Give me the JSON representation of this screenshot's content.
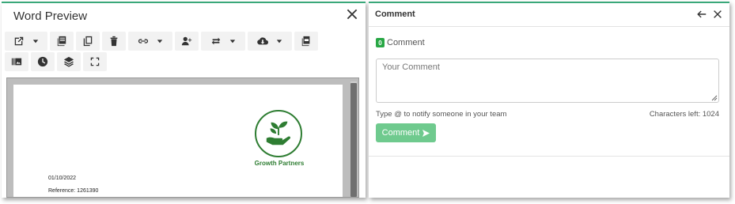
{
  "preview": {
    "title": "Word Preview",
    "toolbar_row1": [
      {
        "icon": "external-link-icon",
        "dropdown": true
      },
      {
        "icon": "copy-pages-icon",
        "dropdown": false
      },
      {
        "icon": "duplicate-icon",
        "dropdown": false
      },
      {
        "icon": "trash-icon",
        "dropdown": false
      },
      {
        "icon": "link-icon",
        "dropdown": true
      },
      {
        "icon": "add-user-icon",
        "dropdown": false
      },
      {
        "icon": "swap-icon",
        "dropdown": true
      },
      {
        "icon": "cloud-download-icon",
        "dropdown": true
      },
      {
        "icon": "pdf-icon",
        "dropdown": false
      }
    ],
    "toolbar_row2": [
      {
        "icon": "gallery-icon"
      },
      {
        "icon": "clock-icon"
      },
      {
        "icon": "layers-icon"
      },
      {
        "icon": "fullscreen-icon"
      }
    ],
    "document": {
      "logo_text": "Growth Partners",
      "date": "01/10/2022",
      "reference": "Reference: 1261390"
    }
  },
  "comment": {
    "title": "Comment",
    "count": "0",
    "count_label": "Comment",
    "placeholder": "Your Comment",
    "hint": "Type @ to notify someone in your team",
    "chars_left": "Characters left: 1024",
    "submit_label": "Comment"
  },
  "colors": {
    "accent": "#3aa87a",
    "badge": "#28a745",
    "submit": "#6fca8e",
    "logo": "#2e7d32"
  }
}
